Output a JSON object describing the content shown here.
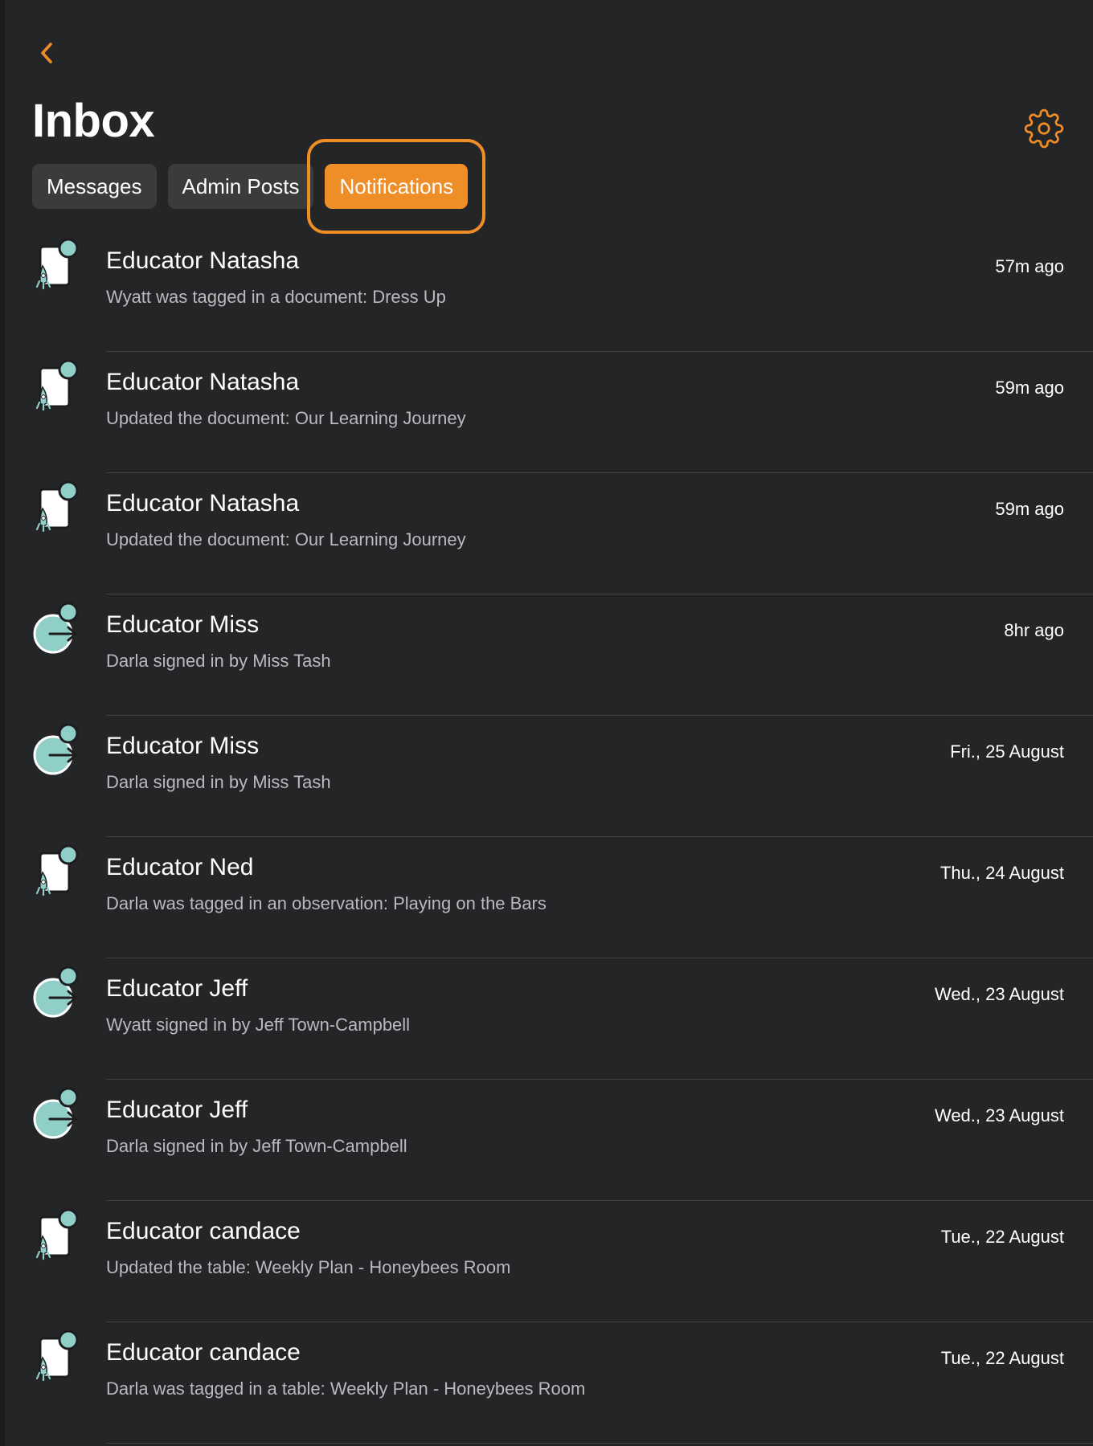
{
  "header": {
    "title": "Inbox",
    "back_icon": "chevron-left-icon",
    "settings_icon": "gear-icon"
  },
  "colors": {
    "accent": "#ef8d26",
    "background": "#242526",
    "tab_inactive": "#3a3b3d",
    "icon_teal": "#8fcfc8",
    "secondary_text": "#b9babd"
  },
  "tabs": [
    {
      "label": "Messages",
      "active": false
    },
    {
      "label": "Admin Posts",
      "active": false
    },
    {
      "label": "Notifications",
      "active": true
    }
  ],
  "notifications": [
    {
      "icon": "document-icon",
      "sender": "Educator Natasha",
      "summary": "Wyatt was tagged in a document: Dress Up",
      "time": "57m ago"
    },
    {
      "icon": "document-icon",
      "sender": "Educator Natasha",
      "summary": "Updated the document: Our Learning Journey",
      "time": "59m ago"
    },
    {
      "icon": "document-icon",
      "sender": "Educator Natasha",
      "summary": "Updated the document: Our Learning Journey",
      "time": "59m ago"
    },
    {
      "icon": "sign-in-icon",
      "sender": "Educator Miss",
      "summary": "Darla signed in by Miss Tash",
      "time": "8hr ago"
    },
    {
      "icon": "sign-in-icon",
      "sender": "Educator Miss",
      "summary": "Darla signed in by Miss Tash",
      "time": "Fri., 25 August"
    },
    {
      "icon": "document-icon",
      "sender": "Educator Ned",
      "summary": "Darla was tagged in an observation: Playing on the Bars",
      "time": "Thu., 24 August"
    },
    {
      "icon": "sign-in-icon",
      "sender": "Educator Jeff",
      "summary": "Wyatt signed in by Jeff Town-Campbell",
      "time": "Wed., 23 August"
    },
    {
      "icon": "sign-in-icon",
      "sender": "Educator Jeff",
      "summary": "Darla signed in by Jeff Town-Campbell",
      "time": "Wed., 23 August"
    },
    {
      "icon": "document-icon",
      "sender": "Educator candace",
      "summary": "Updated the table: Weekly Plan - Honeybees Room",
      "time": "Tue., 22 August"
    },
    {
      "icon": "document-icon",
      "sender": "Educator candace",
      "summary": "Darla was tagged in a table: Weekly Plan - Honeybees Room",
      "time": "Tue., 22 August"
    }
  ]
}
